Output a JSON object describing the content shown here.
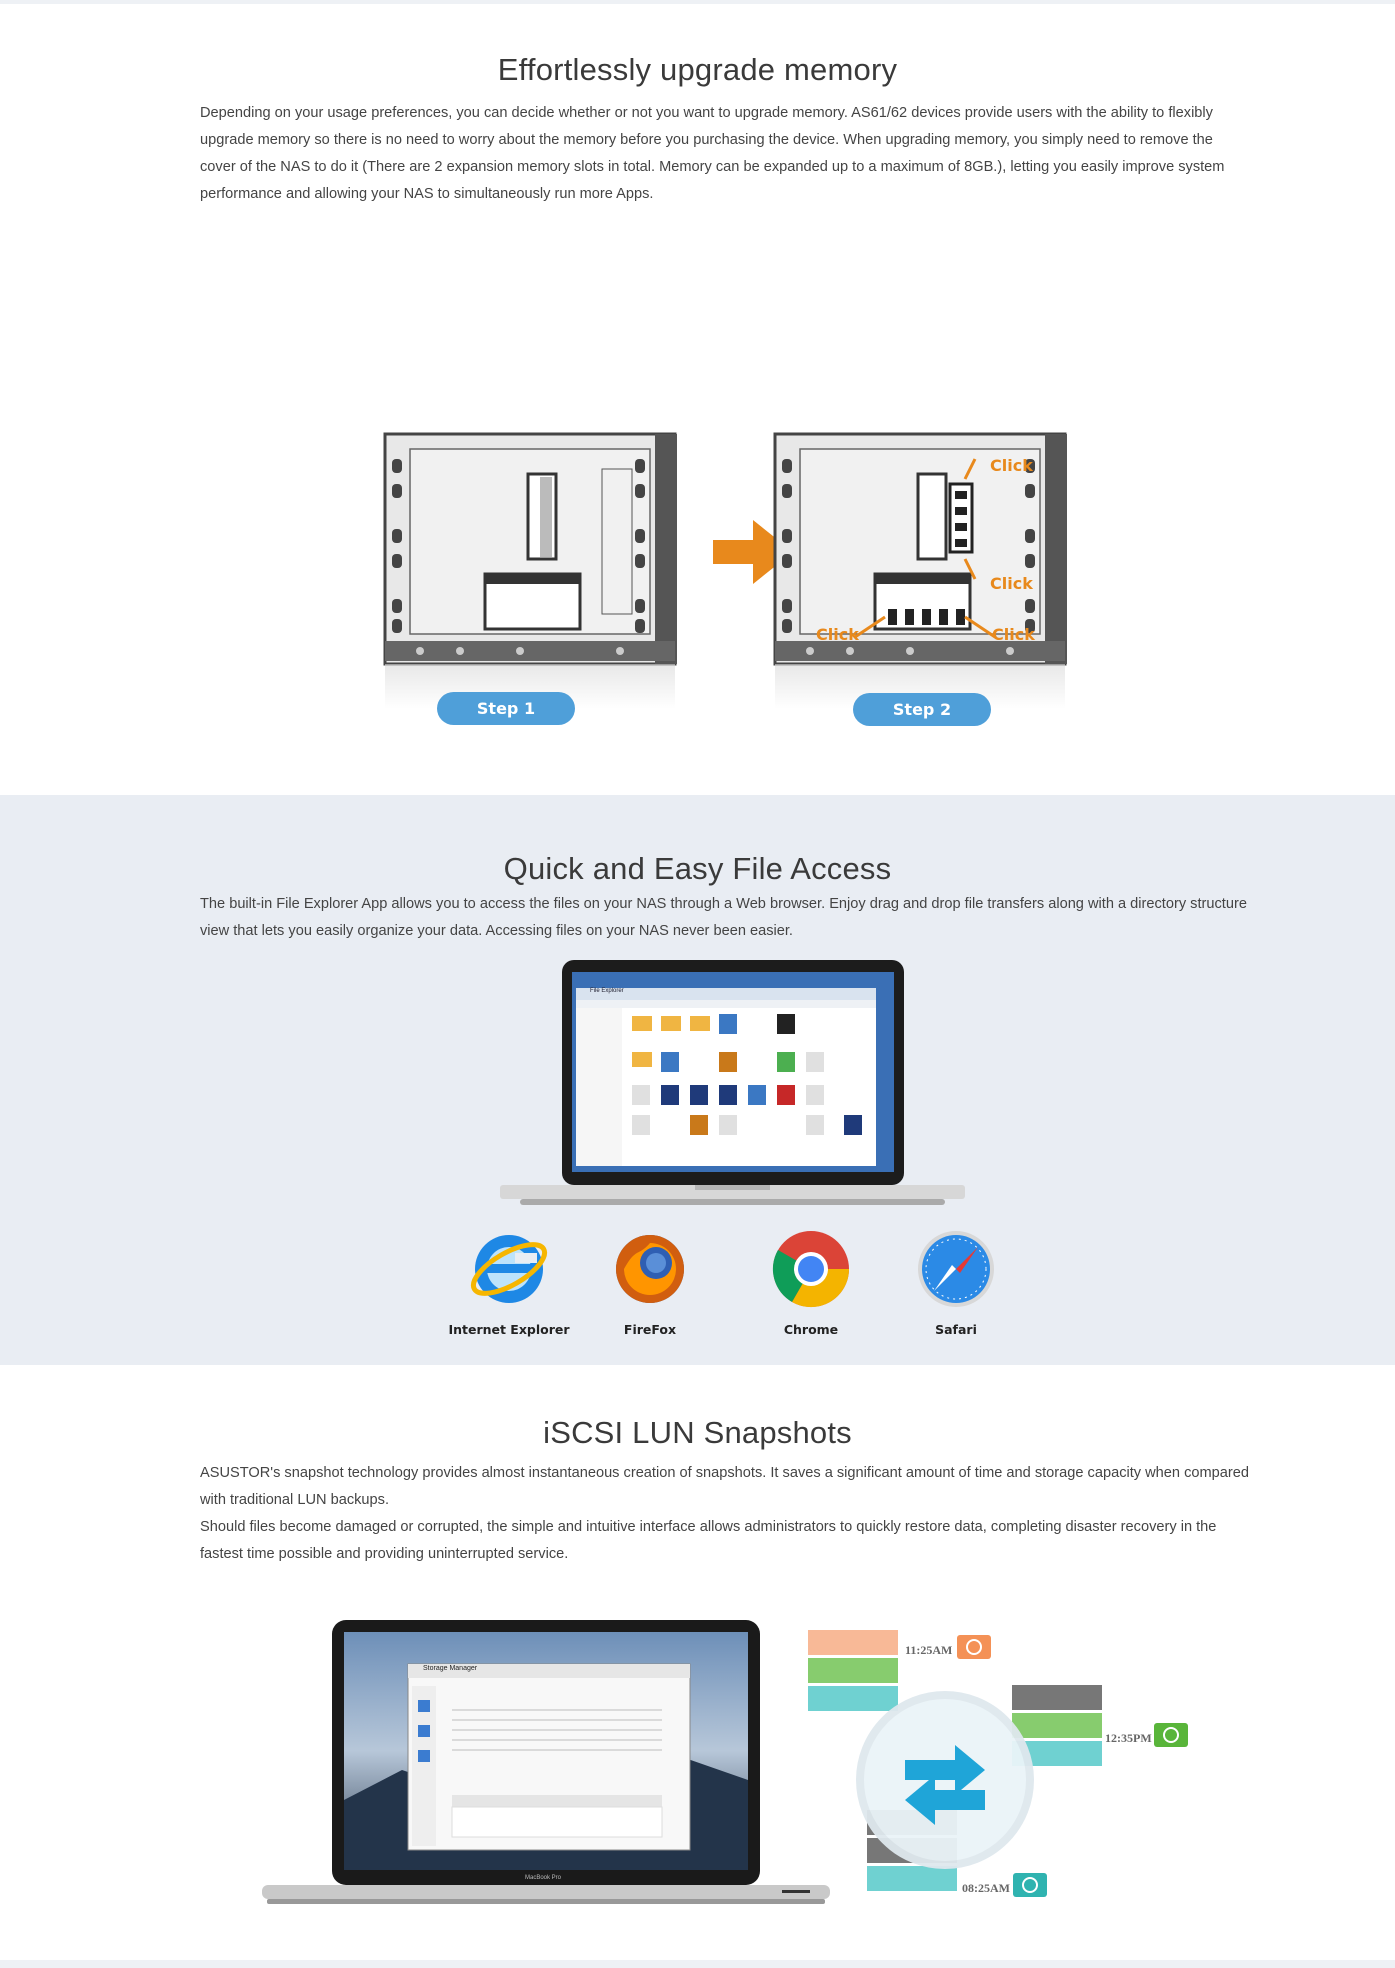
{
  "memory": {
    "title": "Effortlessly upgrade memory",
    "body": "Depending on your usage preferences, you can decide whether or not you want to upgrade memory. AS61/62 devices provide users with the ability to flexibly upgrade memory so there is no need to worry about the memory before you purchasing the device. When upgrading memory, you simply need to remove the cover of the NAS to do it (There are 2 expansion memory slots in total. Memory can be expanded up to a maximum of 8GB.), letting you easily improve system performance and allowing your NAS to simultaneously run more Apps.",
    "step1": "Step 1",
    "step2": "Step 2",
    "click": "Click"
  },
  "file_access": {
    "title": "Quick and Easy File Access",
    "body": "The built-in File Explorer App allows you to access the files on your NAS through a Web browser. Enjoy drag and drop file transfers along with a directory structure view that lets you easily organize your data. Accessing files on your NAS never been easier.",
    "window_title": "File Explorer",
    "browsers": [
      {
        "label": "Internet Explorer",
        "icon": "ie-icon"
      },
      {
        "label": "FireFox",
        "icon": "firefox-icon"
      },
      {
        "label": "Chrome",
        "icon": "chrome-icon"
      },
      {
        "label": "Safari",
        "icon": "safari-icon"
      }
    ]
  },
  "snapshots": {
    "title": "iSCSI LUN Snapshots",
    "body1": "ASUSTOR's snapshot technology provides almost instantaneous creation of snapshots. It saves a significant amount of time and storage capacity when compared with traditional LUN backups.",
    "body2": "Should files become damaged or corrupted, the simple and intuitive interface allows administrators to quickly restore data, completing disaster recovery in the fastest time possible and providing uninterrupted service.",
    "window_title": "Storage Manager",
    "laptop_label": "MacBook Pro",
    "times": [
      "11:25AM",
      "12:35PM",
      "08:25AM"
    ]
  },
  "colors": {
    "accent_blue": "#4f9fd9",
    "orange": "#e8891c",
    "section_bg": "#e9edf3"
  }
}
